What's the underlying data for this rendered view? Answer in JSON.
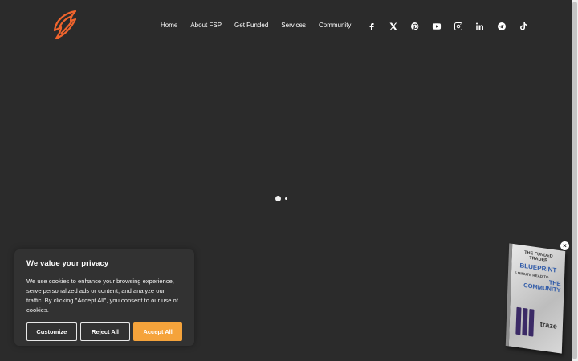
{
  "nav": {
    "items": [
      "Home",
      "About FSP",
      "Get Funded",
      "Services",
      "Community"
    ]
  },
  "social": [
    "facebook-icon",
    "x-icon",
    "pinterest-icon",
    "youtube-icon",
    "instagram-icon",
    "linkedin-icon",
    "telegram-icon",
    "tiktok-icon"
  ],
  "colors": {
    "background": "#2b2b2b",
    "accent": "#f5a33b",
    "logo": "#f0642d"
  },
  "cookie": {
    "title": "We value your privacy",
    "text": "We use cookies to enhance your browsing experience, serve personalized ads or content, and analyze our traffic. By clicking \"Accept All\", you consent to our use of cookies.",
    "customize": "Customize",
    "reject": "Reject All",
    "accept": "Accept All"
  },
  "book": {
    "line1": "THE FUNDED TRADER",
    "line2": "BLUEPRINT",
    "line3": "5 MINUTE READ TO",
    "line4": "THE COMMUNITY",
    "brand": "traze"
  },
  "carousel": {
    "slides": 2,
    "active": 0
  }
}
